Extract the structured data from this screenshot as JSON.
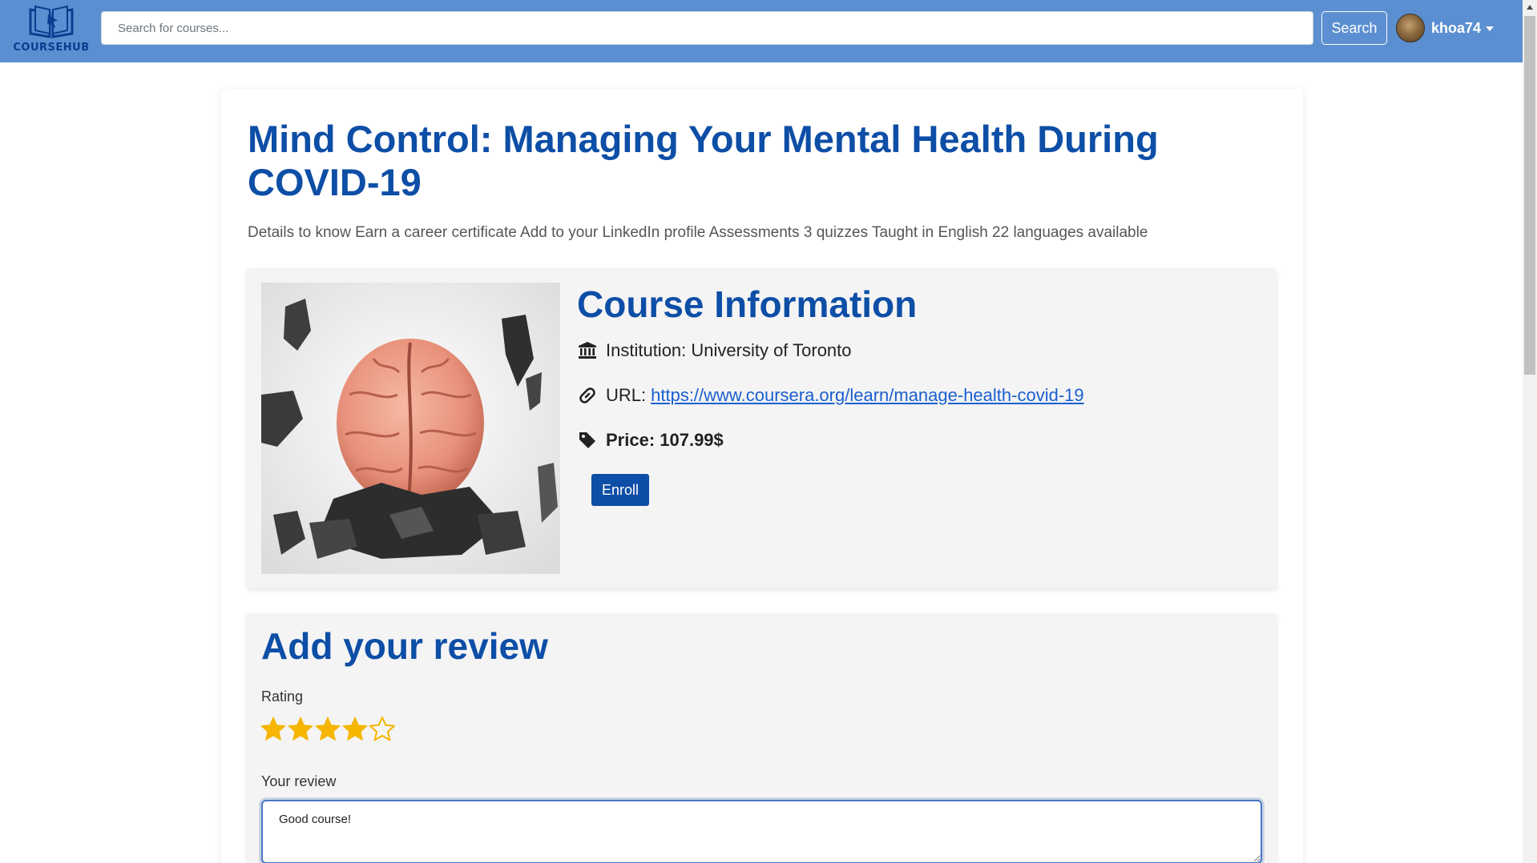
{
  "brand": {
    "name": "COURSEHUB"
  },
  "search": {
    "placeholder": "Search for courses...",
    "button_label": "Search"
  },
  "user": {
    "username": "khoa74"
  },
  "course": {
    "title": "Mind Control: Managing Your Mental Health During COVID-19",
    "description": "Details to know Earn a career certificate Add to your LinkedIn profile Assessments 3 quizzes Taught in English 22 languages available"
  },
  "info": {
    "heading": "Course Information",
    "institution": "Institution: University of Toronto",
    "url_label": "URL:",
    "url": "https://www.coursera.org/learn/manage-health-covid-19",
    "price": "Price: 107.99$",
    "enroll_label": "Enroll"
  },
  "review": {
    "heading": "Add your review",
    "rating_label": "Rating",
    "rating_value": 4,
    "rating_max": 5,
    "review_label": "Your review",
    "review_text": "Good course!"
  },
  "colors": {
    "navbar": "#5b8fd1",
    "accent": "#0d4ea6",
    "star": "#f5b500",
    "link": "#1a5fd0"
  },
  "icons": {
    "institution": "bank-icon",
    "url": "link-icon",
    "price": "tag-icon",
    "star_filled": "star-filled-icon",
    "star_empty": "star-outline-icon"
  }
}
